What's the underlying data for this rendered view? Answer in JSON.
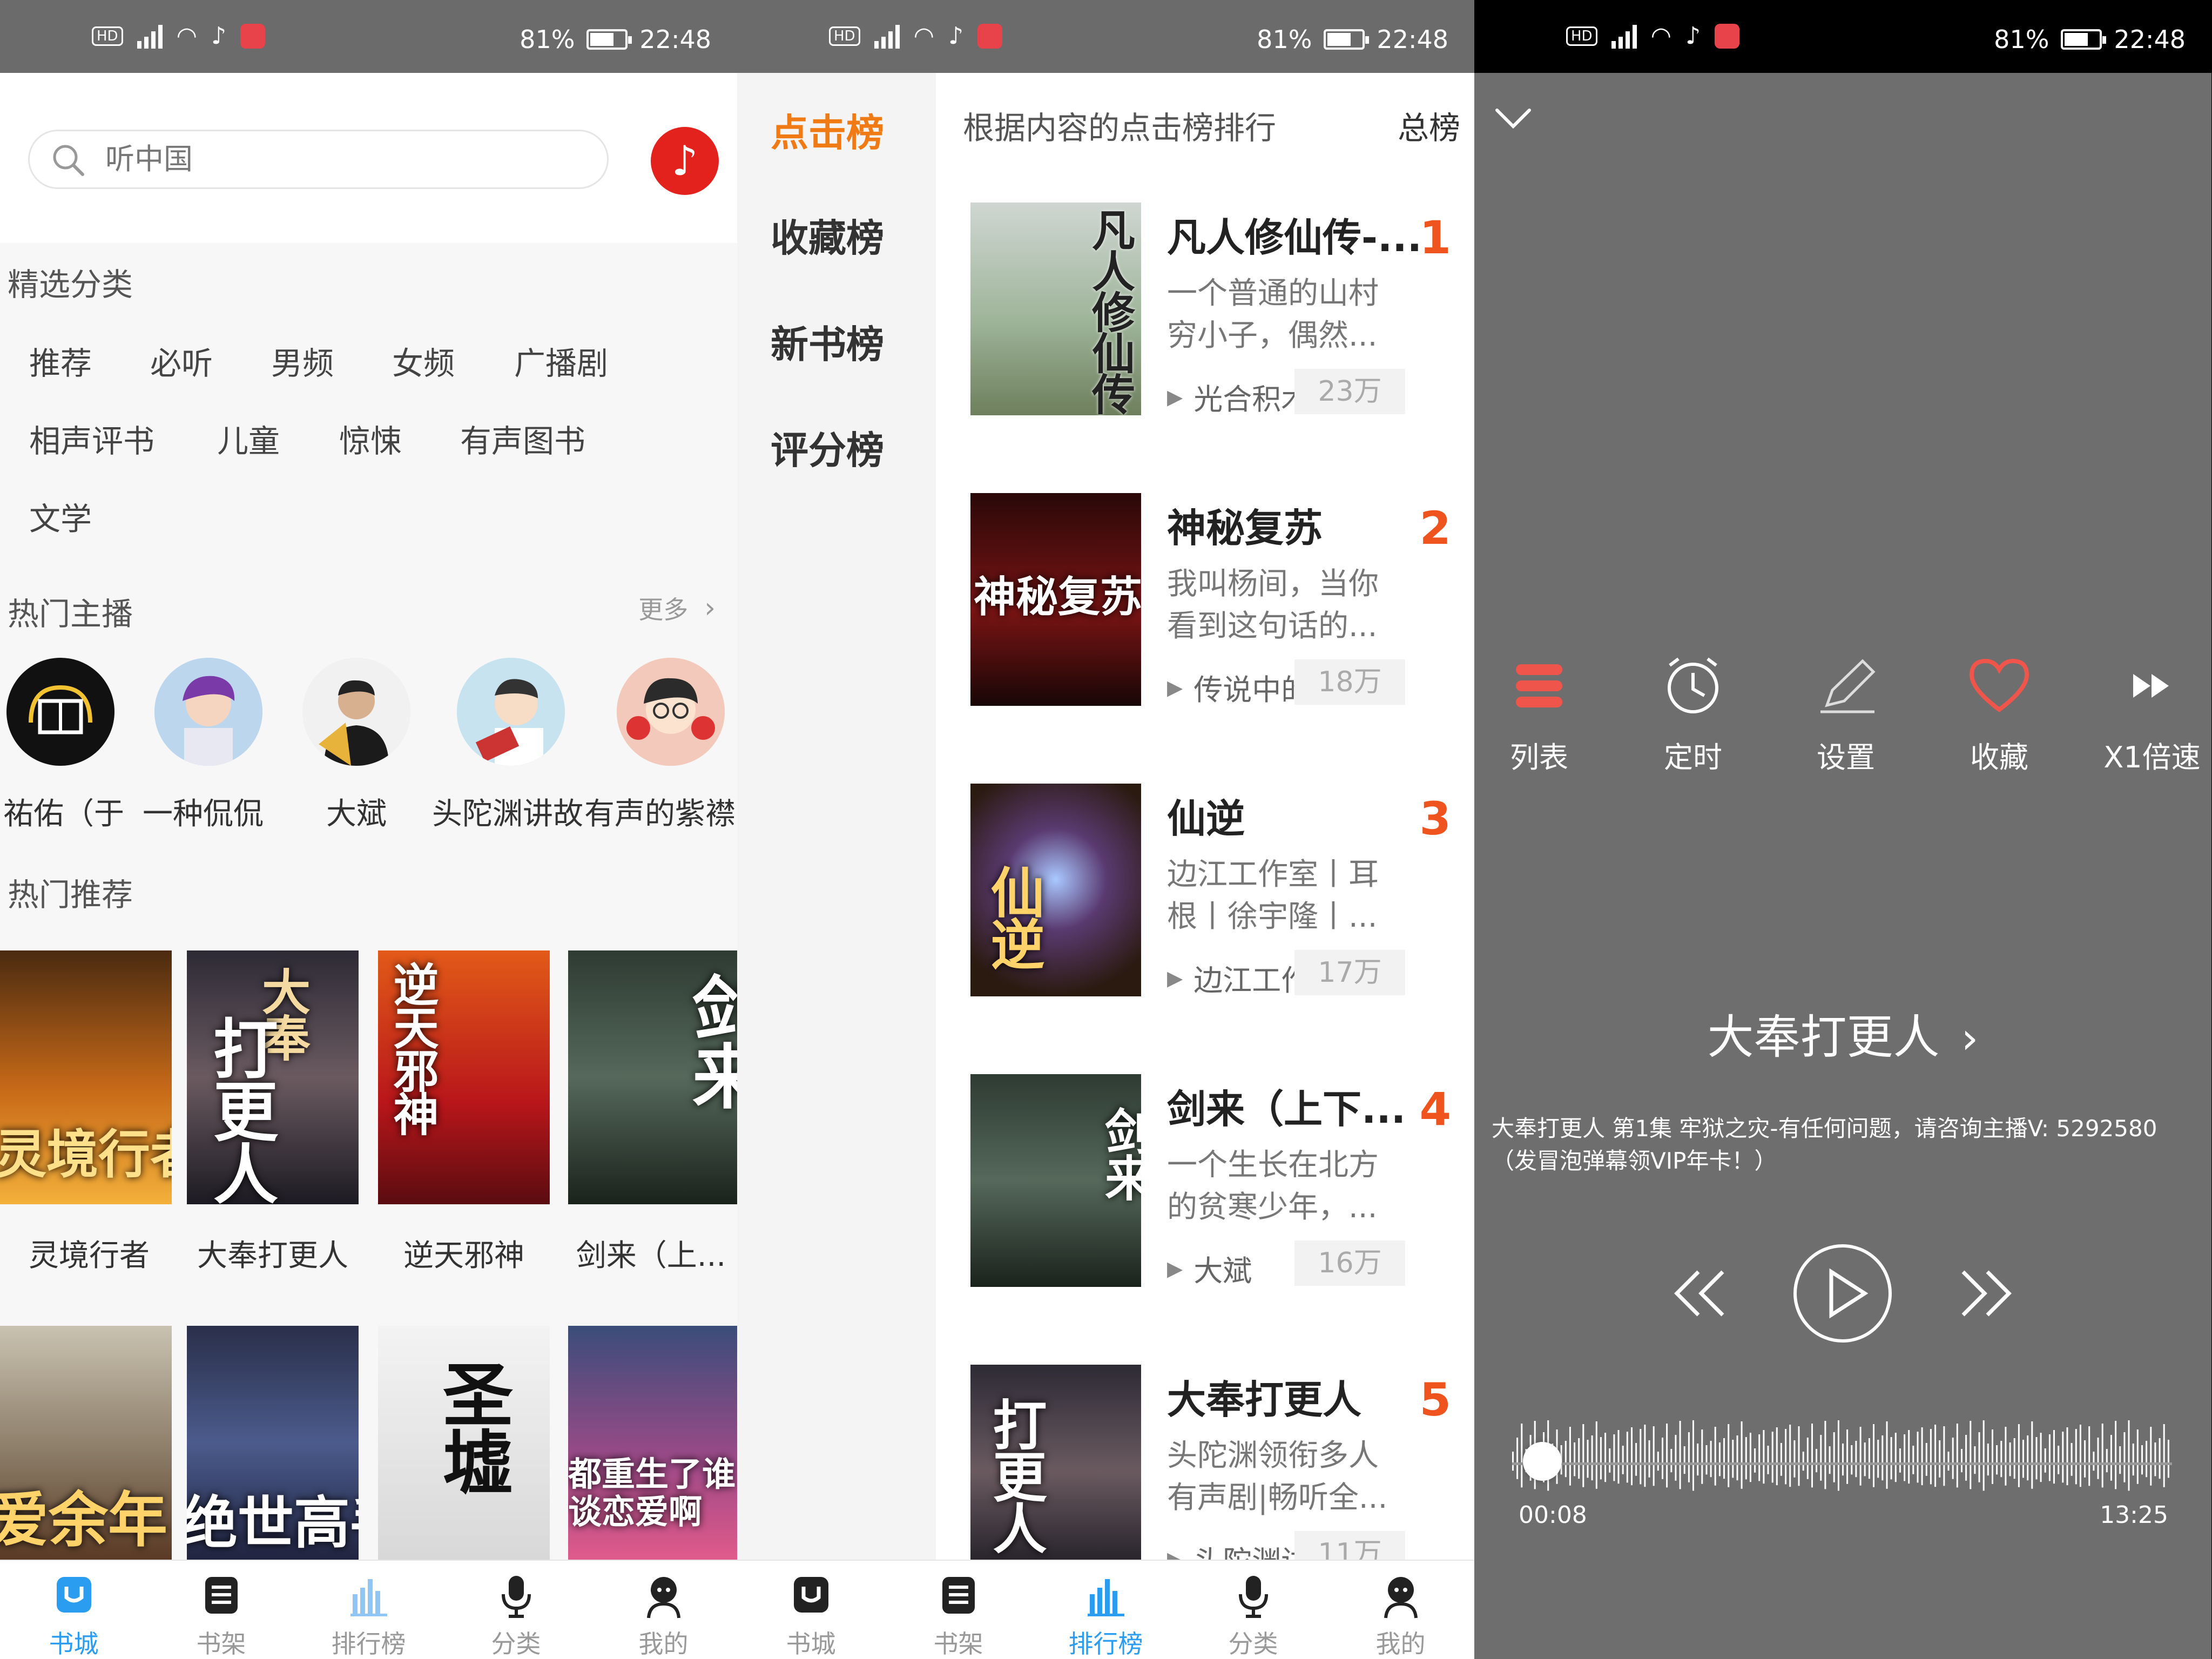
{
  "status_bar": {
    "battery": "81%",
    "time": "22:48",
    "hd": "HD",
    "net": "4G"
  },
  "store": {
    "search_placeholder": "听中国",
    "categories_title": "精选分类",
    "categories": [
      "推荐",
      "必听",
      "男频",
      "女频",
      "广播剧",
      "相声评书",
      "儿童",
      "惊悚",
      "有声图书",
      "文学"
    ],
    "hosts_title": "热门主播",
    "more": "更多",
    "hosts": [
      "祐佑（于",
      "一种侃侃",
      "大斌",
      "头陀渊讲故",
      "有声的紫襟"
    ],
    "recommend_title": "热门推荐",
    "books": [
      "灵境行者",
      "大奉打更人",
      "逆天邪神",
      "剑来（上..."
    ],
    "covers_row1": [
      "灵境行者",
      "大奉",
      "打更人",
      "逆天邪神",
      "剑来"
    ],
    "covers_row2": [
      "爱余年",
      "绝世高手",
      "圣墟",
      "都重生了谁谈恋爱啊"
    ]
  },
  "nav": [
    "书城",
    "书架",
    "排行榜",
    "分类",
    "我的"
  ],
  "rank": {
    "tabs": [
      "点击榜",
      "收藏榜",
      "新书榜",
      "评分榜"
    ],
    "header": "根据内容的点击榜排行",
    "scope": "总榜",
    "items": [
      {
        "title": "凡人修仙传-...",
        "rank": "1",
        "desc": "一个普通的山村穷小子，偶然...",
        "author": "光合积木",
        "plays": "23万",
        "cover": "凡人修仙传"
      },
      {
        "title": "神秘复苏",
        "rank": "2",
        "desc": "我叫杨间，当你看到这句话的...",
        "author": "传说中的",
        "plays": "18万",
        "cover": "神秘复苏"
      },
      {
        "title": "仙逆",
        "rank": "3",
        "desc": "边江工作室丨耳根丨徐宇隆丨...",
        "author": "边江工作",
        "plays": "17万",
        "cover": "仙逆"
      },
      {
        "title": "剑来（上下...",
        "rank": "4",
        "desc": "一个生长在北方的贫寒少年，...",
        "author": "大斌",
        "plays": "16万",
        "cover": "剑来"
      },
      {
        "title": "大奉打更人",
        "rank": "5",
        "desc": "头陀渊领衔多人有声剧|畅听全...",
        "author": "头陀渊讲",
        "plays": "11万",
        "cover": "打更人"
      }
    ]
  },
  "player": {
    "tools": [
      "列表",
      "定时",
      "设置",
      "收藏",
      "X1倍速"
    ],
    "title": "大奉打更人",
    "desc": "大奉打更人 第1集 牢狱之灾-有任何问题，请咨询主播V: 5292580（发冒泡弹幕领VIP年卡！）",
    "current": "00:08",
    "total": "13:25",
    "progress": 0.01
  },
  "colors": {
    "accent_orange": "#f07a14",
    "rank_red": "#f0541e",
    "nav_blue": "#2b9df0",
    "music_red": "#e3221d",
    "heart": "#f0554b"
  }
}
